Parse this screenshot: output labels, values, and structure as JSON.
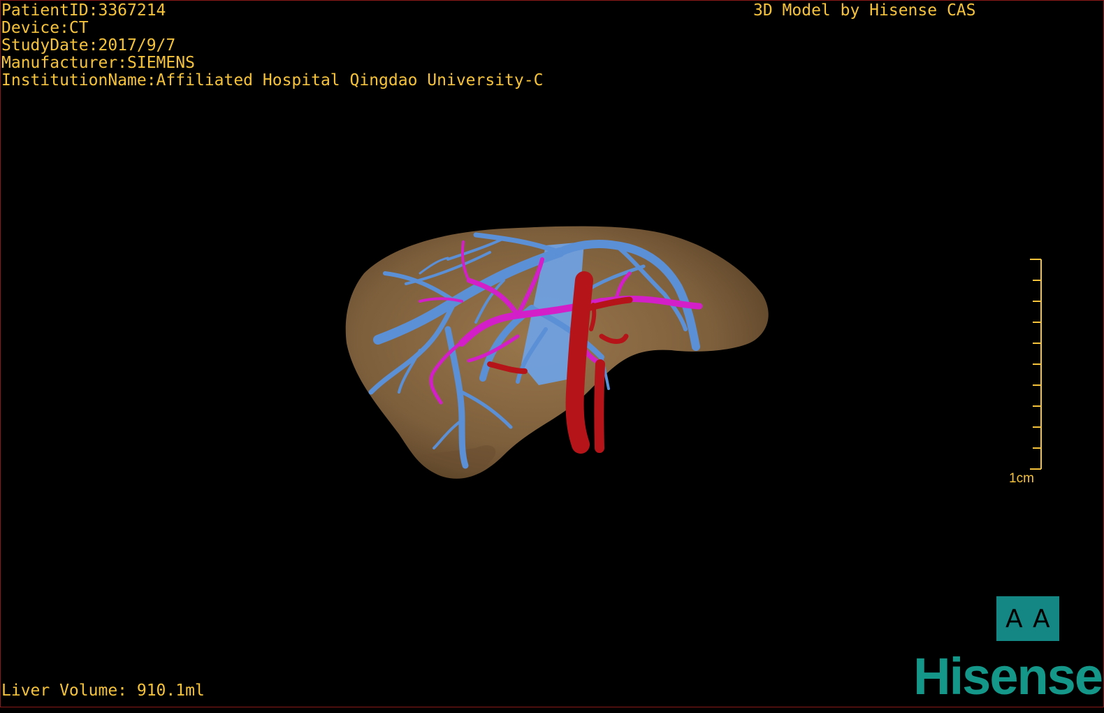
{
  "patient_info": {
    "patient_id": "PatientID:3367214",
    "device": "Device:CT",
    "study_date": "StudyDate:2017/9/7",
    "manufacturer": "Manufacturer:SIEMENS",
    "institution": "InstitutionName:Affiliated Hospital Qingdao University-C"
  },
  "watermark": "3D Model by Hisense CAS",
  "liver_volume": "Liver Volume: 910.1ml",
  "scale": {
    "label": "1cm",
    "ticks": 11
  },
  "orientation_cube": {
    "left_glyph": "A",
    "right_glyph": "A"
  },
  "logo": "Hisense",
  "colors": {
    "text": "#f5c33b",
    "liver": "#8a6a45",
    "hepatic_vein": "#5b8fd6",
    "portal_vein": "#d21fc8",
    "artery": "#b51519",
    "logo": "#149689"
  }
}
